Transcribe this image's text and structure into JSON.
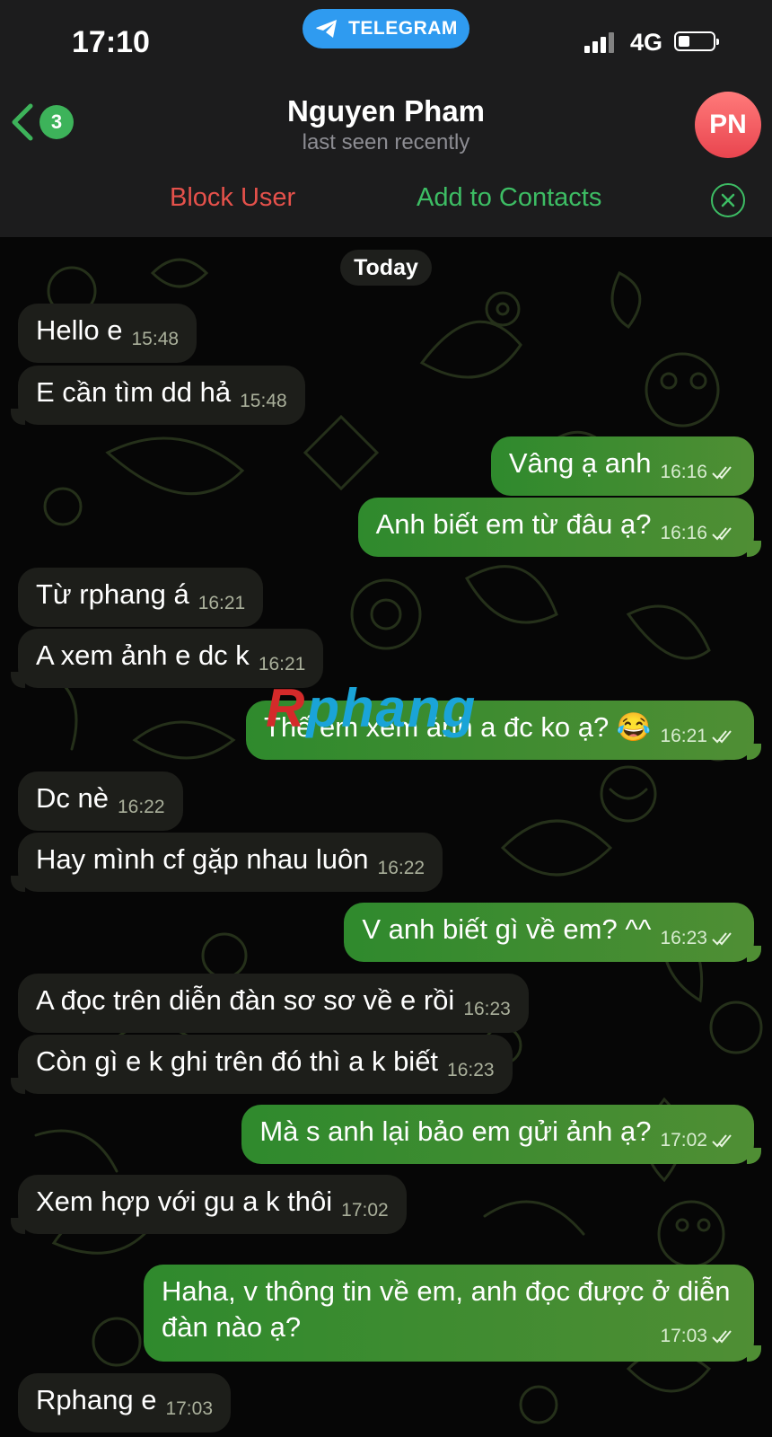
{
  "status_bar": {
    "time": "17:10",
    "app_pill": "TELEGRAM",
    "network": "4G"
  },
  "header": {
    "unread_count": "3",
    "contact_name": "Nguyen Pham",
    "contact_status": "last seen recently",
    "avatar_initials": "PN"
  },
  "actions": {
    "block_label": "Block User",
    "add_label": "Add to Contacts"
  },
  "chat": {
    "date_divider": "Today"
  },
  "messages": [
    {
      "dir": "in",
      "text": "Hello e",
      "time": "15:48"
    },
    {
      "dir": "in",
      "text": "E cần tìm dd hả",
      "time": "15:48"
    },
    {
      "dir": "out",
      "text": "Vâng ạ anh",
      "time": "16:16"
    },
    {
      "dir": "out",
      "text": "Anh biết em từ đâu ạ?",
      "time": "16:16"
    },
    {
      "dir": "in",
      "text": "Từ rphang á",
      "time": "16:21"
    },
    {
      "dir": "in",
      "text": "A xem ảnh e dc k",
      "time": "16:21"
    },
    {
      "dir": "out",
      "text": "Thế em xem ảnh a đc ko ạ? 😂",
      "time": "16:21"
    },
    {
      "dir": "in",
      "text": "Dc nè",
      "time": "16:22"
    },
    {
      "dir": "in",
      "text": "Hay mình cf gặp nhau luôn",
      "time": "16:22"
    },
    {
      "dir": "out",
      "text": "V anh biết gì về em? ^^",
      "time": "16:23"
    },
    {
      "dir": "in",
      "text": "A đọc trên diễn đàn sơ sơ về e rồi",
      "time": "16:23"
    },
    {
      "dir": "in",
      "text": "Còn gì e k ghi trên đó thì a k biết",
      "time": "16:23"
    },
    {
      "dir": "out",
      "text": "Mà s anh lại bảo em gửi ảnh ạ?",
      "time": "17:02"
    },
    {
      "dir": "in",
      "text": "Xem hợp với gu a k thôi",
      "time": "17:02"
    },
    {
      "dir": "out",
      "text": "Haha, v thông tin về em, anh đọc được ở diễn đàn nào ạ?",
      "time": "17:03"
    },
    {
      "dir": "in",
      "text": "Rphang e",
      "time": "17:03"
    }
  ],
  "watermark": {
    "part1": "R",
    "part2": "phang"
  },
  "colors": {
    "incoming_bubble": "#1d1e1a",
    "outgoing_bubble": "#3b8c31",
    "block_red": "#e5514b",
    "contacts_green": "#3dbd64",
    "pill_blue": "#2f9bf0"
  }
}
